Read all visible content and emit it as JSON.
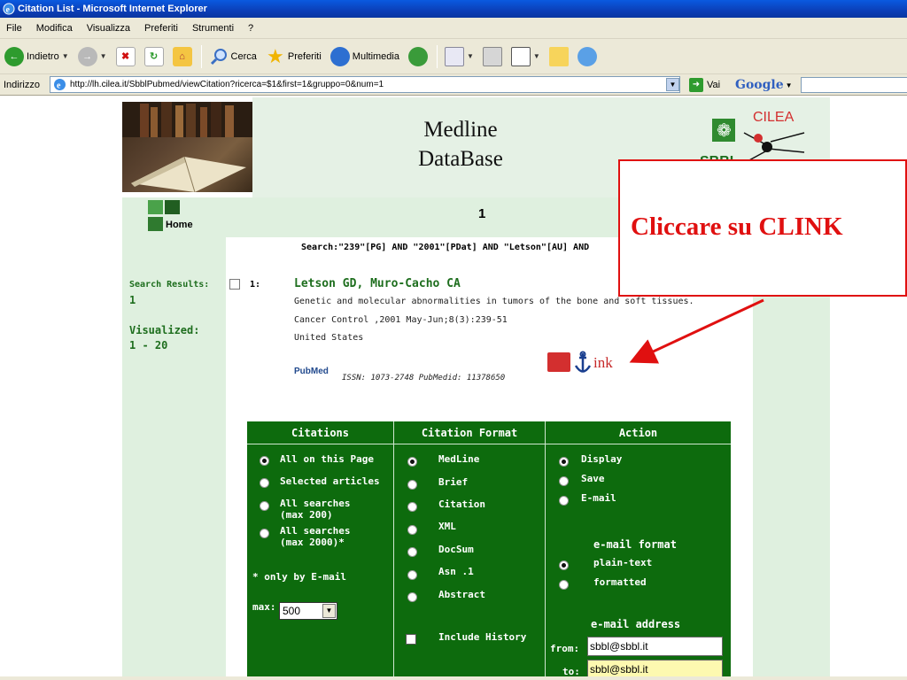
{
  "browser": {
    "title": "Citation List - Microsoft Internet Explorer",
    "menu": [
      "File",
      "Modifica",
      "Visualizza",
      "Preferiti",
      "Strumenti",
      "?"
    ],
    "toolbar": {
      "back": "Indietro",
      "search": "Cerca",
      "favorites": "Preferiti",
      "media": "Multimedia"
    },
    "address_label": "Indirizzo",
    "url": "http://lh.cilea.it/SbblPubmed/viewCitation?ricerca=$1&first=1&gruppo=0&num=1",
    "go_label": "Vai",
    "google_label": "Google"
  },
  "header": {
    "db_title_line1": "Medline",
    "db_title_line2": "DataBase",
    "org_label": "CILEA",
    "sbbl_label": "SBBL"
  },
  "nav": {
    "home_label": "Home",
    "page_number": "1"
  },
  "search": {
    "query": "Search:\"239\"[PG] AND \"2001\"[PDat] AND \"Letson\"[AU] AND",
    "results_label": "Search Results:",
    "results_count": "1",
    "visualized_label": "Visualized:",
    "visualized_range": "1 - 20"
  },
  "result": {
    "number": "1:",
    "authors": "Letson GD, Muro-Cacho CA",
    "title": "Genetic and molecular abnormalities in tumors of the bone and soft tissues.",
    "source": "Cancer Control ,2001 May-Jun;8(3):239-51",
    "country": "United States",
    "pubmed_label": "PubMed",
    "issn_line": "ISSN: 1073-2748 PubMedid: 11378650",
    "clink_label": "ink"
  },
  "annotation": {
    "text": "Cliccare su CLINK"
  },
  "options": {
    "headers": [
      "Citations",
      "Citation Format",
      "Action"
    ],
    "citations": [
      {
        "label": "All on this Page",
        "selected": true
      },
      {
        "label": "Selected articles",
        "selected": false
      },
      {
        "label": "All searches",
        "label2": "(max 200)",
        "selected": false
      },
      {
        "label": "All searches",
        "label2": "(max 2000)*",
        "selected": false
      }
    ],
    "email_note": "* only by E-mail",
    "max_label": "max:",
    "max_value": "500",
    "formats": [
      {
        "label": "MedLine",
        "selected": true
      },
      {
        "label": "Brief",
        "selected": false
      },
      {
        "label": "Citation",
        "selected": false
      },
      {
        "label": "XML",
        "selected": false
      },
      {
        "label": "DocSum",
        "selected": false
      },
      {
        "label": "Asn .1",
        "selected": false
      },
      {
        "label": "Abstract",
        "selected": false
      }
    ],
    "include_history": "Include History",
    "actions": [
      {
        "label": "Display",
        "selected": true
      },
      {
        "label": "Save",
        "selected": false
      },
      {
        "label": "E-mail",
        "selected": false
      }
    ],
    "email_format_label": "e-mail format",
    "email_formats": [
      {
        "label": "plain-text",
        "selected": true
      },
      {
        "label": "formatted",
        "selected": false
      }
    ],
    "email_address_label": "e-mail address",
    "from_label": "from:",
    "from_value": "sbbl@sbbl.it",
    "to_label": "to:",
    "to_value": "sbbl@sbbl.it"
  },
  "colors": {
    "accent_green": "#0d6b0d",
    "annotation_red": "#e01010",
    "light_green": "#dff0df"
  }
}
